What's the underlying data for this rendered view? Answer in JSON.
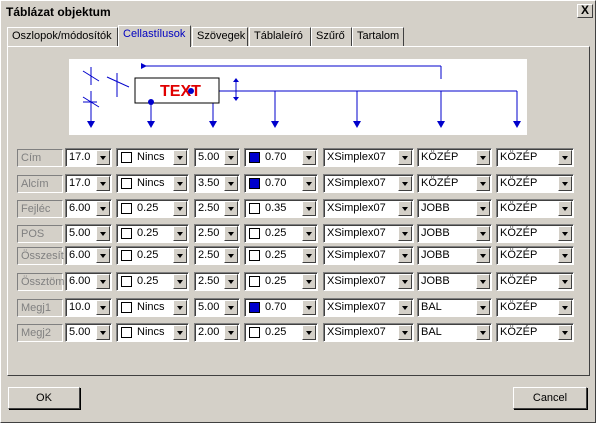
{
  "window": {
    "title": "Táblázat objektum",
    "close_label": "X"
  },
  "tabs": [
    {
      "label": "Oszlopok/módosítók"
    },
    {
      "label": "Cellastílusok"
    },
    {
      "label": "Szövegek"
    },
    {
      "label": "Táblaleíró"
    },
    {
      "label": "Szűrő"
    },
    {
      "label": "Tartalom"
    }
  ],
  "active_tab": "Cellastílusok",
  "diagram": {
    "sample_text": "TEXT"
  },
  "rows": [
    {
      "label": "Cím",
      "height": "17.0",
      "frame": "Nincs",
      "frame_swatch": "#ffffff",
      "width": "5.00",
      "pen": "0.70",
      "pen_swatch": "#0000cc",
      "font": "XSimplex07",
      "halign": "KÖZÉP",
      "valign": "KÖZÉP"
    },
    {
      "label": "Alcím",
      "height": "17.0",
      "frame": "Nincs",
      "frame_swatch": "#ffffff",
      "width": "3.50",
      "pen": "0.70",
      "pen_swatch": "#0000cc",
      "font": "XSimplex07",
      "halign": "KÖZÉP",
      "valign": "KÖZÉP"
    },
    {
      "label": "Fejléc",
      "height": "6.00",
      "frame": "0.25",
      "frame_swatch": "#ffffff",
      "width": "2.50",
      "pen": "0.35",
      "pen_swatch": "#ffffff",
      "font": "XSimplex07",
      "halign": "JOBB",
      "valign": "KÖZÉP"
    },
    {
      "label": "POS",
      "height": "5.00",
      "frame": "0.25",
      "frame_swatch": "#ffffff",
      "width": "2.50",
      "pen": "0.25",
      "pen_swatch": "#ffffff",
      "font": "XSimplex07",
      "halign": "JOBB",
      "valign": "KÖZÉP"
    },
    {
      "label": "Összesít",
      "height": "6.00",
      "frame": "0.25",
      "frame_swatch": "#ffffff",
      "width": "2.50",
      "pen": "0.25",
      "pen_swatch": "#ffffff",
      "font": "XSimplex07",
      "halign": "JOBB",
      "valign": "KÖZÉP"
    },
    {
      "label": "Össztöm",
      "height": "6.00",
      "frame": "0.25",
      "frame_swatch": "#ffffff",
      "width": "2.50",
      "pen": "0.25",
      "pen_swatch": "#ffffff",
      "font": "XSimplex07",
      "halign": "JOBB",
      "valign": "KÖZÉP"
    },
    {
      "label": "Megj1",
      "height": "10.0",
      "frame": "Nincs",
      "frame_swatch": "#ffffff",
      "width": "5.00",
      "pen": "0.70",
      "pen_swatch": "#0000cc",
      "font": "XSimplex07",
      "halign": "BAL",
      "valign": "KÖZÉP"
    },
    {
      "label": "Megj2",
      "height": "5.00",
      "frame": "Nincs",
      "frame_swatch": "#ffffff",
      "width": "2.00",
      "pen": "0.25",
      "pen_swatch": "#ffffff",
      "font": "XSimplex07",
      "halign": "BAL",
      "valign": "KÖZÉP"
    }
  ],
  "buttons": {
    "ok": "OK",
    "cancel": "Cancel"
  },
  "colors": {
    "accent": "#0000cc",
    "text_red": "#e00000",
    "face": "#d4d0c8"
  }
}
